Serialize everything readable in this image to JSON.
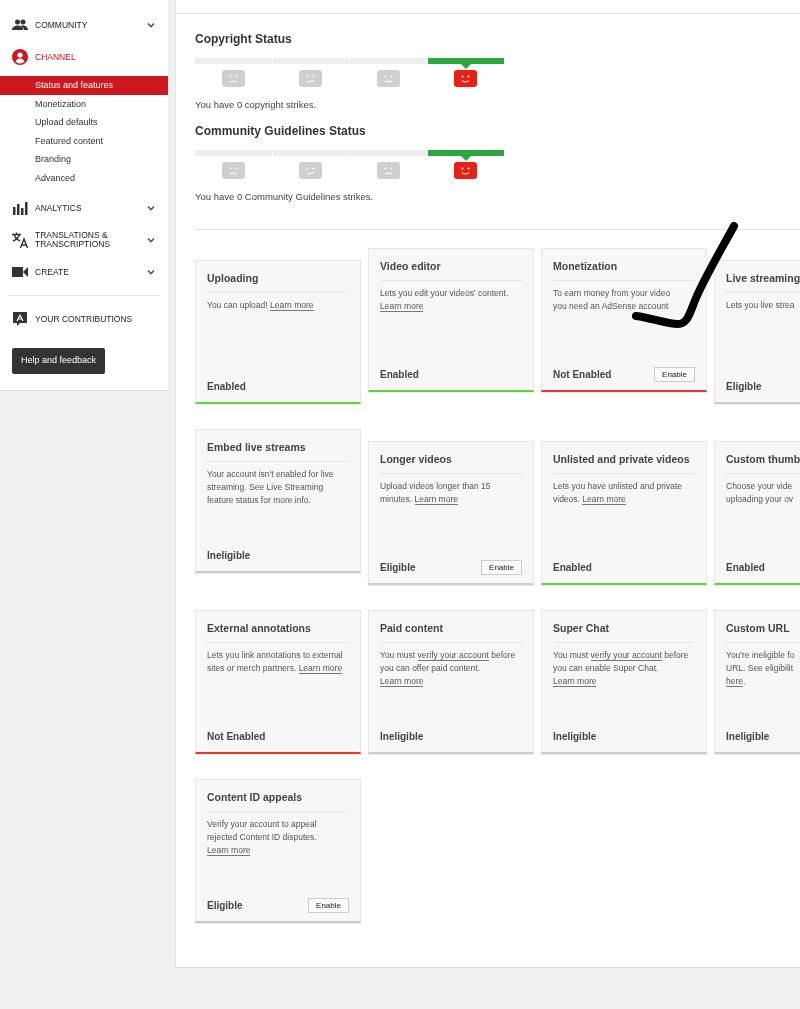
{
  "sidebar": {
    "items": [
      {
        "kind": "people",
        "label": "COMMUNITY",
        "caret": true,
        "active": false
      },
      {
        "kind": "account",
        "label": "CHANNEL",
        "caret": false,
        "active": true,
        "children": [
          {
            "label": "Status and features",
            "selected": true
          },
          {
            "label": "Monetization",
            "selected": false
          },
          {
            "label": "Upload defaults",
            "selected": false
          },
          {
            "label": "Featured content",
            "selected": false
          },
          {
            "label": "Branding",
            "selected": false
          },
          {
            "label": "Advanced",
            "selected": false
          }
        ]
      },
      {
        "kind": "bars",
        "label": "ANALYTICS",
        "caret": true,
        "active": false
      },
      {
        "kind": "translate",
        "label": "TRANSLATIONS & TRANSCRIPTIONS",
        "caret": true,
        "active": false
      },
      {
        "kind": "camera",
        "label": "CREATE",
        "caret": true,
        "active": false
      },
      {
        "kind": "contrib",
        "label": "YOUR CONTRIBUTIONS",
        "caret": false,
        "active": false
      }
    ],
    "help_button": "Help and feedback"
  },
  "statuses": [
    {
      "title": "Copyright Status",
      "segments": [
        {
          "kind": "sad",
          "selected": false
        },
        {
          "kind": "meh",
          "selected": false
        },
        {
          "kind": "neutral",
          "selected": false
        },
        {
          "kind": "happy",
          "selected": true
        }
      ],
      "message": "You have 0 copyright strikes."
    },
    {
      "title": "Community Guidelines Status",
      "segments": [
        {
          "kind": "sad",
          "selected": false
        },
        {
          "kind": "meh",
          "selected": false
        },
        {
          "kind": "neutral",
          "selected": false
        },
        {
          "kind": "happy",
          "selected": true
        }
      ],
      "message": "You have 0 Community Guidelines strikes."
    }
  ],
  "features": [
    {
      "title": "Uploading",
      "desc": [
        {
          "text": "You can upload! "
        },
        {
          "link": "Learn more"
        }
      ],
      "status": "Enabled",
      "kind": "enabled"
    },
    {
      "title": "Video editor",
      "desc": [
        {
          "text": "Lets you edit your videos' content. "
        },
        {
          "link": "Learn more"
        }
      ],
      "status": "Enabled",
      "kind": "enabled"
    },
    {
      "title": "Monetization",
      "desc": [
        {
          "text": "To earn money from your video\nyou need an AdSense account"
        }
      ],
      "status": "Not Enabled",
      "kind": "not_enabled",
      "button": "Enable"
    },
    {
      "title": "Live streaming",
      "desc": [
        {
          "text": "Lets you live strea"
        }
      ],
      "status": "Eligible",
      "kind": "neutral"
    },
    {
      "title": "Embed live streams",
      "desc": [
        {
          "text": "Your account isn't enabled for live streaming. See Live Streaming feature status for more info."
        }
      ],
      "status": "Ineligible",
      "kind": "neutral"
    },
    {
      "title": "Longer videos",
      "desc": [
        {
          "text": "Upload videos longer than 15 minutes. "
        },
        {
          "link": "Learn more"
        }
      ],
      "status": "Eligible",
      "kind": "neutral",
      "button": "Enable"
    },
    {
      "title": "Unlisted and private videos",
      "desc": [
        {
          "text": "Lets you have unlisted and private videos. "
        },
        {
          "link": "Learn more"
        }
      ],
      "status": "Enabled",
      "kind": "enabled"
    },
    {
      "title": "Custom thumb",
      "desc": [
        {
          "text": "Choose your vide\nuploading your ov"
        }
      ],
      "status": "Enabled",
      "kind": "enabled"
    },
    {
      "title": "External annotations",
      "desc": [
        {
          "text": "Lets you link annotations to external sites or merch partners. "
        },
        {
          "link": "Learn more"
        }
      ],
      "status": "Not Enabled",
      "kind": "not_enabled"
    },
    {
      "title": "Paid content",
      "desc": [
        {
          "text": "You must "
        },
        {
          "link": "verify your account"
        },
        {
          "text": " before you can offer paid content. "
        },
        {
          "link": "Learn more"
        }
      ],
      "status": "Ineligible",
      "kind": "neutral"
    },
    {
      "title": "Super Chat",
      "desc": [
        {
          "text": "You must "
        },
        {
          "link": "verify your account"
        },
        {
          "text": " before you can enable Super Chat. "
        },
        {
          "link": "Learn more"
        }
      ],
      "status": "Ineligible",
      "kind": "neutral"
    },
    {
      "title": "Custom URL",
      "desc": [
        {
          "text": "You're ineligible fo\nURL. See eligibilit\n"
        },
        {
          "link": "here"
        },
        {
          "text": "."
        }
      ],
      "status": "Ineligible",
      "kind": "neutral"
    },
    {
      "title": "Content ID appeals",
      "desc": [
        {
          "text": "Verify your account to appeal rejected Content ID disputes. "
        },
        {
          "link": "Learn more"
        }
      ],
      "status": "Eligible",
      "kind": "neutral",
      "button": "Enable"
    }
  ]
}
